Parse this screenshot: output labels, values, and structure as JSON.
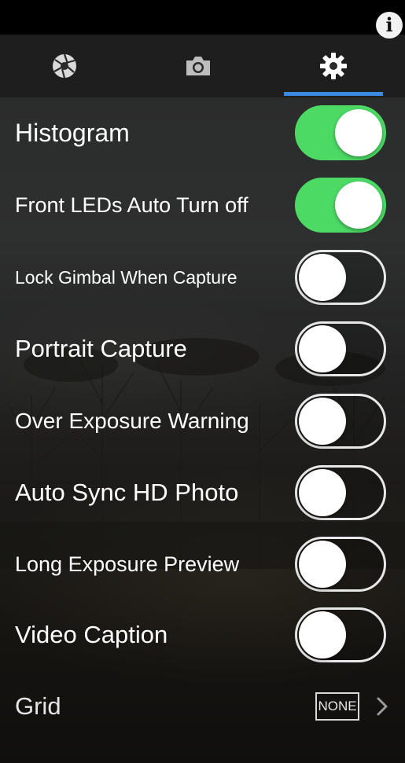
{
  "header": {
    "info_icon": "info-icon",
    "info_glyph": "i"
  },
  "tabs": [
    {
      "icon": "aperture-icon",
      "selected": false
    },
    {
      "icon": "camera-icon",
      "selected": false
    },
    {
      "icon": "gear-icon",
      "selected": true
    }
  ],
  "colors": {
    "accent": "#3a8be0",
    "toggle_on": "#4cd964",
    "text": "#ffffff"
  },
  "settings": [
    {
      "label": "Histogram",
      "on": true
    },
    {
      "label": "Front LEDs Auto Turn off",
      "on": true
    },
    {
      "label": "Lock Gimbal When Capture",
      "on": false
    },
    {
      "label": "Portrait Capture",
      "on": false
    },
    {
      "label": "Over Exposure Warning",
      "on": false
    },
    {
      "label": "Auto Sync HD Photo",
      "on": false
    },
    {
      "label": "Long Exposure Preview",
      "on": false
    },
    {
      "label": "Video Caption",
      "on": false
    }
  ],
  "grid": {
    "label": "Grid",
    "value": "NONE",
    "chevron_icon": "chevron-right-icon"
  }
}
